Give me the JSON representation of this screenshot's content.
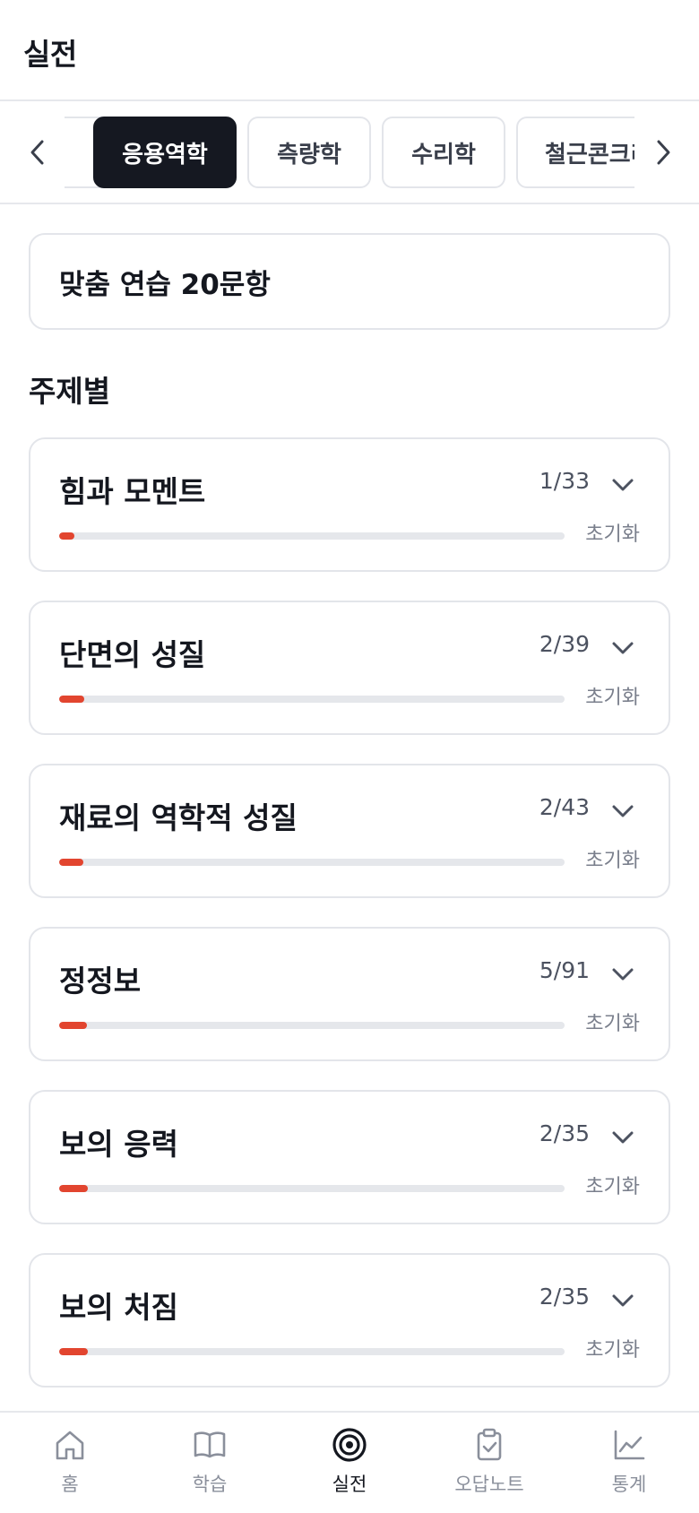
{
  "header": {
    "title": "실전"
  },
  "subject_tabs": {
    "items": [
      {
        "label": "",
        "active": false
      },
      {
        "label": "응용역학",
        "active": true
      },
      {
        "label": "측량학",
        "active": false
      },
      {
        "label": "수리학",
        "active": false
      },
      {
        "label": "철근콘크리",
        "active": false
      }
    ]
  },
  "practice": {
    "label": "맞춤 연습 20문항"
  },
  "section": {
    "title": "주제별"
  },
  "topics": [
    {
      "name": "힘과 모멘트",
      "count": "1/33",
      "progress": 0.03,
      "reset_label": "초기화"
    },
    {
      "name": "단면의 성질",
      "count": "2/39",
      "progress": 0.05,
      "reset_label": "초기화"
    },
    {
      "name": "재료의 역학적 성질",
      "count": "2/43",
      "progress": 0.047,
      "reset_label": "초기화"
    },
    {
      "name": "정정보",
      "count": "5/91",
      "progress": 0.055,
      "reset_label": "초기화"
    },
    {
      "name": "보의 응력",
      "count": "2/35",
      "progress": 0.057,
      "reset_label": "초기화"
    },
    {
      "name": "보의 처짐",
      "count": "2/35",
      "progress": 0.057,
      "reset_label": "초기화"
    }
  ],
  "bottom_nav": [
    {
      "label": "홈",
      "icon": "home-icon",
      "active": false
    },
    {
      "label": "학습",
      "icon": "book-icon",
      "active": false
    },
    {
      "label": "실전",
      "icon": "target-icon",
      "active": true
    },
    {
      "label": "오답노트",
      "icon": "clipboard-check-icon",
      "active": false
    },
    {
      "label": "통계",
      "icon": "line-chart-icon",
      "active": false
    }
  ],
  "colors": {
    "accent": "#e2452f",
    "active_tab_bg": "#151821",
    "border": "#e3e5ea",
    "track": "#e5e7eb"
  }
}
